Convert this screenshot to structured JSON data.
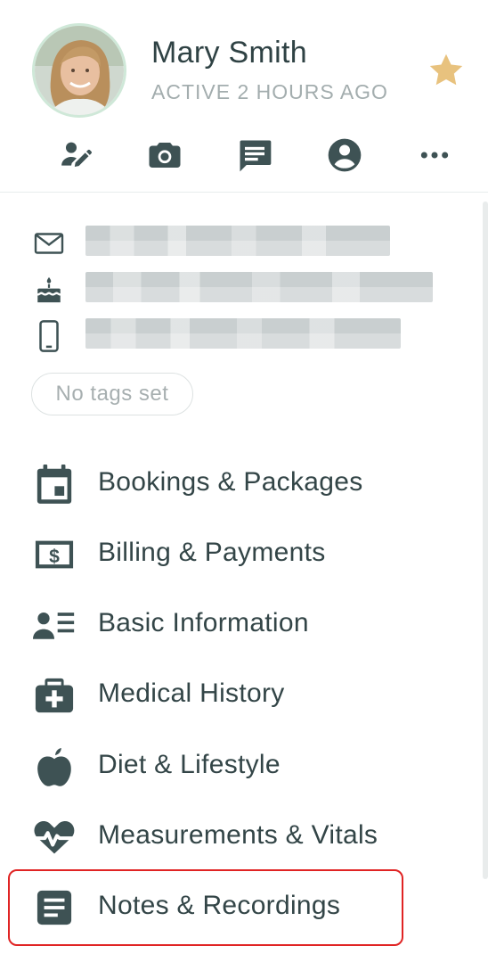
{
  "profile": {
    "name": "Mary Smith",
    "status": "ACTIVE 2 HOURS AGO",
    "favorite_icon": "star-icon",
    "favorite_color": "#e8c27e"
  },
  "actions": [
    {
      "icon": "edit-user-icon"
    },
    {
      "icon": "camera-icon"
    },
    {
      "icon": "message-icon"
    },
    {
      "icon": "account-circle-icon"
    },
    {
      "icon": "more-horizontal-icon"
    }
  ],
  "contact": {
    "email_icon": "email-icon",
    "birthday_icon": "birthday-cake-icon",
    "phone_icon": "phone-icon"
  },
  "tags": {
    "empty_label": "No tags set"
  },
  "menu": {
    "items": [
      {
        "label": "Bookings & Packages",
        "icon": "calendar-icon"
      },
      {
        "label": "Billing & Payments",
        "icon": "dollar-bill-icon"
      },
      {
        "label": "Basic Information",
        "icon": "user-list-icon"
      },
      {
        "label": "Medical History",
        "icon": "medical-kit-icon"
      },
      {
        "label": "Diet & Lifestyle",
        "icon": "apple-icon"
      },
      {
        "label": "Measurements & Vitals",
        "icon": "heart-pulse-icon"
      },
      {
        "label": "Notes & Recordings",
        "icon": "notes-icon"
      }
    ]
  },
  "colors": {
    "icon": "#3e5254",
    "text": "#334547",
    "muted": "#a3adae",
    "highlight": "#e02424"
  }
}
